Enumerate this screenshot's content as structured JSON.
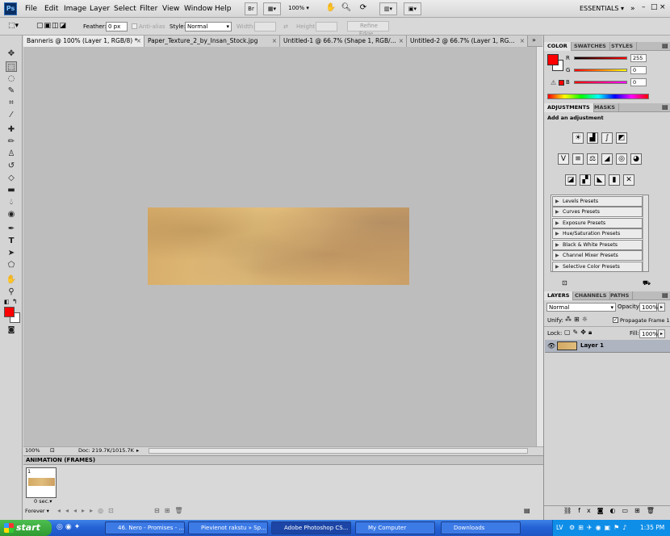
{
  "app": {
    "logo": "Ps",
    "workspace": "ESSENTIALS"
  },
  "menu": [
    "File",
    "Edit",
    "Image",
    "Layer",
    "Select",
    "Filter",
    "View",
    "Window",
    "Help"
  ],
  "menubar_buttons": {
    "bridge": "Br",
    "zoom": "100%"
  },
  "options": {
    "feather_label": "Feather:",
    "feather_value": "0 px",
    "antialias_label": "Anti-alias",
    "style_label": "Style:",
    "style_value": "Normal",
    "width_label": "Width:",
    "height_label": "Height:",
    "refine_label": "Refine Edge..."
  },
  "tabs": [
    {
      "label": "Banneris @ 100% (Layer 1, RGB/8) *",
      "close": "×"
    },
    {
      "label": "Paper_Texture_2_by_Insan_Stock.jpg",
      "close": "×"
    },
    {
      "label": "Untitled-1 @ 66.7% (Shape 1, RGB/...",
      "close": "×"
    },
    {
      "label": "Untitled-2 @ 66.7% (Layer 1, RG...",
      "close": "×"
    }
  ],
  "status": {
    "zoom": "100%",
    "doc": "Doc: 219.7K/1015.7K"
  },
  "animation": {
    "title": "ANIMATION (FRAMES)",
    "frame_number": "1",
    "frame_delay": "0 sec.",
    "loop": "Forever"
  },
  "color_panel": {
    "tabs": [
      "COLOR",
      "SWATCHES",
      "STYLES"
    ],
    "r_label": "R",
    "g_label": "G",
    "b_label": "B",
    "r": "255",
    "g": "0",
    "b": "0"
  },
  "adjustments": {
    "tabs": [
      "ADJUSTMENTS",
      "MASKS"
    ],
    "heading": "Add an adjustment",
    "presets": [
      "Levels Presets",
      "Curves Presets",
      "Exposure Presets",
      "Hue/Saturation Presets",
      "Black & White Presets",
      "Channel Mixer Presets",
      "Selective Color Presets"
    ]
  },
  "layers": {
    "tabs": [
      "LAYERS",
      "CHANNELS",
      "PATHS"
    ],
    "blend_mode": "Normal",
    "opacity_label": "Opacity:",
    "opacity": "100%",
    "unify_label": "Unify:",
    "propagate_label": "Propagate Frame 1",
    "lock_label": "Lock:",
    "fill_label": "Fill:",
    "fill": "100%",
    "layer_name": "Layer 1"
  },
  "taskbar": {
    "start": "start",
    "tasks": [
      "46. Nero - Promises - ...",
      "Pievienot rakstu » Sp...",
      "Adobe Photoshop CS...",
      "My Computer",
      "Downloads"
    ],
    "lang": "LV",
    "time": "1:35 PM"
  },
  "colors": {
    "foreground": "#ff0000",
    "background": "#ffffff",
    "accent": "#0a2f63"
  }
}
